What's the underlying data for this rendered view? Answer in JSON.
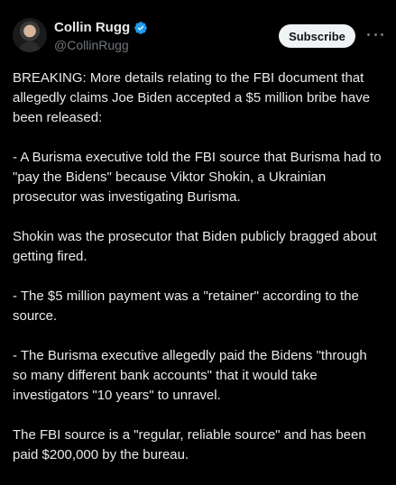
{
  "author": {
    "display_name": "Collin Rugg",
    "handle": "@CollinRugg",
    "verified": true,
    "verified_icon": "verified-badge-icon"
  },
  "actions": {
    "subscribe_label": "Subscribe",
    "more_icon": "more-horizontal-icon"
  },
  "tweet": {
    "paragraphs": [
      [
        "BREAKING: More details relating to the FBI document that",
        "allegedly claims Joe Biden accepted a $5 million bribe have",
        "been released:"
      ],
      [
        "- A Burisma executive told the FBI source that Burisma had to",
        "\"pay the Bidens\" because Viktor Shokin, a Ukrainian",
        "prosecutor was investigating Burisma."
      ],
      [
        "Shokin was the prosecutor that Biden publicly bragged about",
        "getting fired."
      ],
      [
        "- The $5 million payment was a \"retainer\" according to the",
        "source."
      ],
      [
        "- The Burisma executive allegedly paid the Bidens \"through",
        "so many different bank accounts\" that it would take",
        "investigators \"10 years\" to unravel."
      ],
      [
        "The FBI source is a \"regular, reliable source\" and has been",
        "paid $200,000 by the bureau."
      ]
    ]
  },
  "colors": {
    "background": "#000000",
    "text": "#e7e9ea",
    "secondary_text": "#71767b",
    "verified_blue": "#1d9bf0",
    "button_bg": "#eff3f4"
  }
}
